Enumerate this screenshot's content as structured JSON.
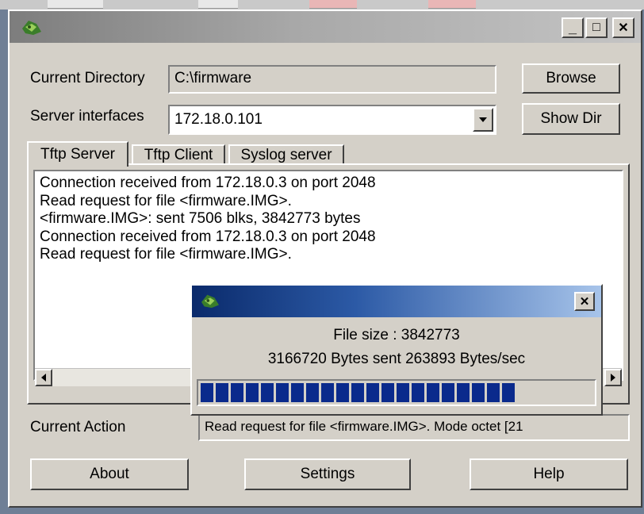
{
  "window": {
    "title": "",
    "controls": {
      "minimize": "_",
      "maximize": "□",
      "close": "✕"
    }
  },
  "current_directory": {
    "label": "Current Directory",
    "value": "C:\\firmware"
  },
  "server_interfaces": {
    "label": "Server interfaces",
    "value": "172.18.0.101"
  },
  "buttons": {
    "browse": "Browse",
    "show_dir": "Show Dir",
    "about": "About",
    "settings": "Settings",
    "help": "Help"
  },
  "tabs": [
    {
      "label": "Tftp Server",
      "active": true
    },
    {
      "label": "Tftp Client",
      "active": false
    },
    {
      "label": "Syslog server",
      "active": false
    }
  ],
  "log": [
    "Connection received from 172.18.0.3 on port 2048",
    "Read request for file <firmware.IMG>.",
    "<firmware.IMG>: sent 7506 blks, 3842773 bytes",
    "Connection received from 172.18.0.3 on port 2048",
    "Read request for file <firmware.IMG>."
  ],
  "current_action": {
    "label": "Current Action",
    "value": "Read request for file <firmware.IMG>. Mode octet [21"
  },
  "progress_dialog": {
    "file_size": "File size : 3842773",
    "bytes_line": "3166720 Bytes sent  263893 Bytes/sec",
    "close": "✕",
    "progress_fraction": 0.82,
    "bar_color": "#0a2a8c"
  },
  "icons": {
    "app": "tftpd-app-icon",
    "dropdown": "chevron-down-icon",
    "scroll_left": "arrow-left-icon",
    "scroll_right": "arrow-right-icon"
  }
}
